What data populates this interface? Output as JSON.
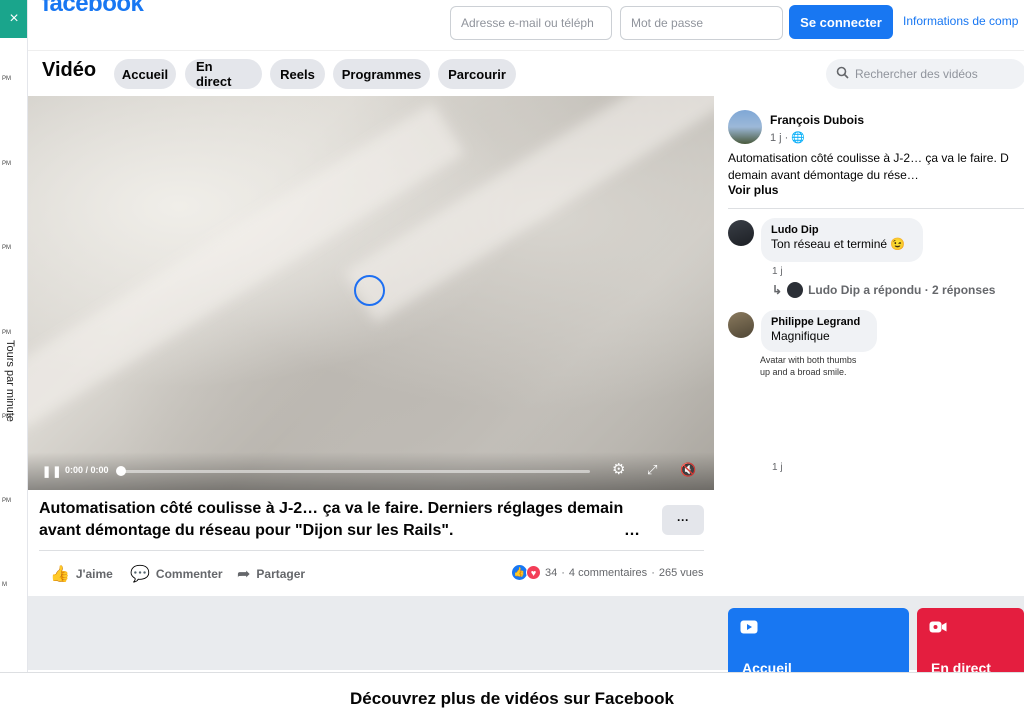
{
  "header": {
    "logo": "facebook",
    "email_placeholder": "Adresse e-mail ou téléph",
    "password_placeholder": "Mot de passe",
    "login_label": "Se connecter",
    "info_link": "Informations de comp"
  },
  "left_strip": {
    "close_glyph": "×",
    "tick_labels": [
      "PM",
      "PM",
      "PM",
      "PM",
      "PM",
      "PM",
      "M"
    ],
    "vertical_label": "Tours par minute"
  },
  "subnav": {
    "title": "Vidéo",
    "tabs": [
      {
        "label": "Accueil"
      },
      {
        "label": "En direct"
      },
      {
        "label": "Reels"
      },
      {
        "label": "Programmes"
      },
      {
        "label": "Parcourir"
      }
    ],
    "search_placeholder": "Rechercher des vidéos"
  },
  "player": {
    "time": "0:00 / 0:00",
    "progress": 0
  },
  "post": {
    "caption": "Automatisation côté coulisse à J-2… ça va le faire. Derniers réglages demain avant démontage du réseau pour \"Dijon sur les Rails\".",
    "more_glyph": "…",
    "options_glyph": "···",
    "actions": {
      "like": "J'aime",
      "comment": "Commenter",
      "share": "Partager"
    },
    "reactions_count": "34",
    "comments_count": "4 commentaires",
    "views": "265 vues",
    "stats_sep": "·"
  },
  "author": {
    "name": "François Dubois",
    "meta": "1 j · 🌐",
    "text_line1": "Automatisation côté coulisse à J-2… ça va le faire. D",
    "text_line2": "demain avant démontage du rése…",
    "see_more": "Voir plus"
  },
  "comments": [
    {
      "name": "Ludo Dip",
      "text": "Ton réseau et terminé 😉",
      "time": "1 j",
      "reply": "Ludo Dip a répondu · 2 réponses"
    },
    {
      "name": "Philippe Legrand",
      "text": "Magnifique",
      "alt": "Avatar with both thumbs up and a broad smile.",
      "time": "1 j"
    }
  ],
  "cards": [
    {
      "label": "Accueil",
      "color": "#1877f2",
      "icon": "play-icon"
    },
    {
      "label": "En direct",
      "color": "#e41e3f",
      "icon": "live-camera-icon"
    }
  ],
  "footer": {
    "title": "Découvrez plus de vidéos sur Facebook"
  }
}
